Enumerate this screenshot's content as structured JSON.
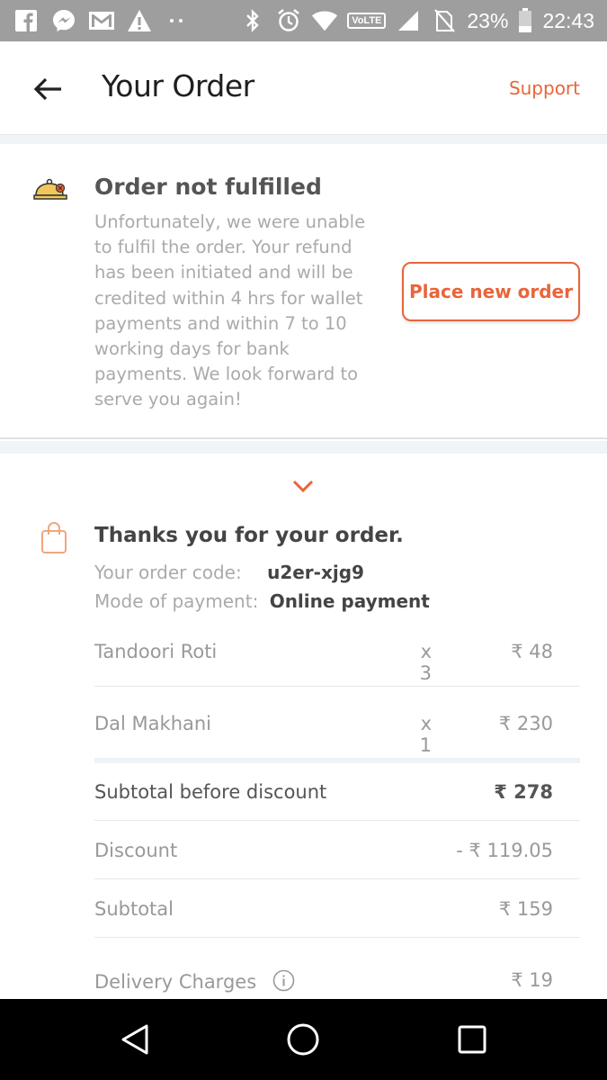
{
  "status_bar": {
    "battery": "23%",
    "time": "22:43",
    "network_badge": "VoLTE",
    "icons": [
      "facebook-icon",
      "messenger-icon",
      "gmail-icon",
      "warning-icon",
      "more-icon",
      "bluetooth-icon",
      "alarm-icon",
      "wifi-icon",
      "signal-icon",
      "no-sim-icon",
      "battery-icon"
    ]
  },
  "header": {
    "title": "Your Order",
    "support_label": "Support",
    "accent_color": "#e8653a"
  },
  "status_card": {
    "title": "Order not fulfilled",
    "message": "Unfortunately, we were unable to fulfil the order. Your refund has been initiated and will be credited within 4 hrs for wallet payments and within 7 to 10 working days for bank payments. We look forward to serve you again!",
    "button_label": "Place new order"
  },
  "order": {
    "heading": "Thanks you for your order.",
    "code_label": "Your order code:",
    "code_value": "u2er-xjg9",
    "payment_label": "Mode of payment:",
    "payment_value": "Online payment",
    "items": [
      {
        "name": "Tandoori Roti",
        "qty": "x 3",
        "price": "₹ 48"
      },
      {
        "name": "Dal Makhani",
        "qty": "x 1",
        "price": "₹ 230"
      }
    ],
    "summary": [
      {
        "label": "Subtotal before discount",
        "value": "₹ 278"
      },
      {
        "label": "Discount",
        "value": "- ₹ 119.05"
      },
      {
        "label": "Subtotal",
        "value": "₹ 159"
      },
      {
        "label": "Delivery Charges",
        "value": "₹ 19"
      }
    ]
  }
}
